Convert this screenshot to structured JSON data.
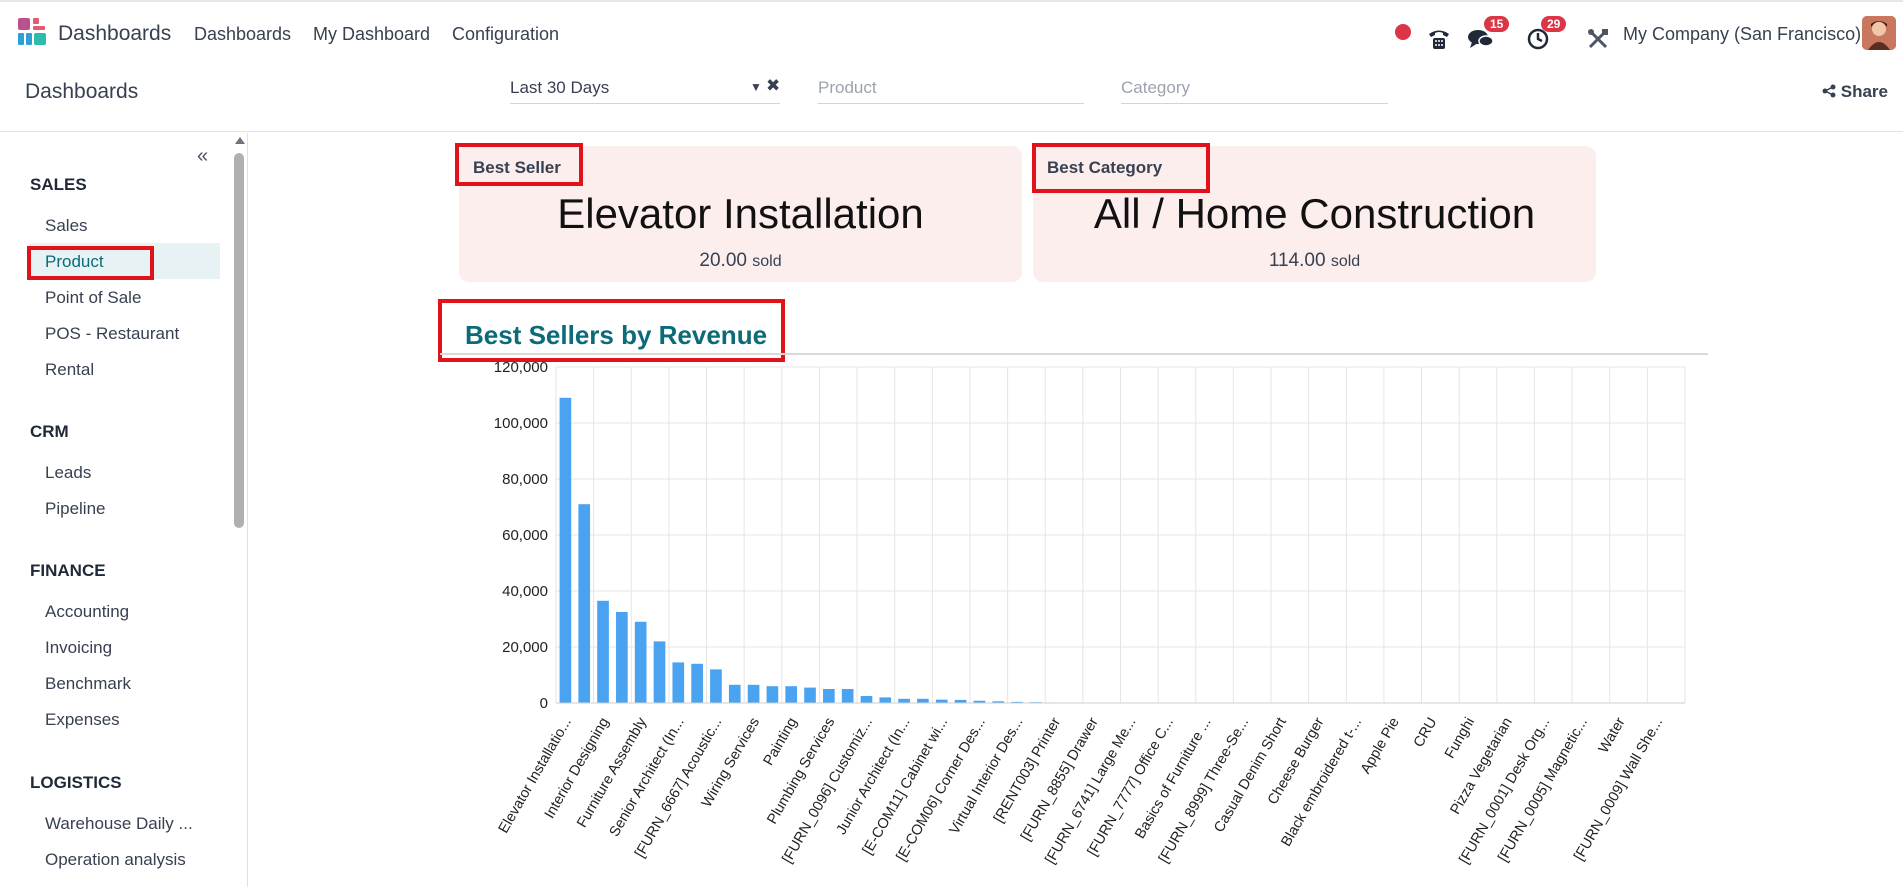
{
  "topbar": {
    "app_name": "Dashboards",
    "menu": [
      "Dashboards",
      "My Dashboard",
      "Configuration"
    ],
    "messages_count": "15",
    "activities_count": "29",
    "company": "My Company (San Francisco)"
  },
  "control": {
    "breadcrumb": "Dashboards",
    "date_filter": "Last 30 Days",
    "product_placeholder": "Product",
    "category_placeholder": "Category",
    "share_label": "Share"
  },
  "sidebar": {
    "sections": [
      {
        "title": "SALES",
        "items": [
          "Sales",
          "Product",
          "Point of Sale",
          "POS - Restaurant",
          "Rental"
        ]
      },
      {
        "title": "CRM",
        "items": [
          "Leads",
          "Pipeline"
        ]
      },
      {
        "title": "FINANCE",
        "items": [
          "Accounting",
          "Invoicing",
          "Benchmark",
          "Expenses"
        ]
      },
      {
        "title": "LOGISTICS",
        "items": [
          "Warehouse Daily ...",
          "Operation analysis"
        ]
      }
    ],
    "active_item": "Product"
  },
  "cards": [
    {
      "label": "Best Seller",
      "value": "Elevator Installation",
      "amount": "20.00",
      "unit": "sold"
    },
    {
      "label": "Best Category",
      "value": "All / Home Construction",
      "amount": "114.00",
      "unit": "sold"
    }
  ],
  "colors": {
    "bar": "#4aa3f0",
    "title": "#0b6b78",
    "card_bg": "#fdeeee",
    "highlight": "#e0121a",
    "active_nav": "#e6f2f3"
  },
  "chart_data": {
    "type": "bar",
    "title": "Best Sellers by Revenue",
    "ylim": [
      0,
      120000
    ],
    "yticks": [
      "0",
      "20,000",
      "40,000",
      "60,000",
      "80,000",
      "100,000",
      "120,000"
    ],
    "grid": true,
    "labels": [
      "Elevator Installatio...",
      "Interior Designing",
      "Furniture Assembly",
      "Senior Architect (In...",
      "[FURN_6667] Acoustic...",
      "Wiring Services",
      "Painting",
      "Plumbing Services",
      "[FURN_0096] Customiz...",
      "Junior Architect (In...",
      "[E-COM11] Cabinet wi...",
      "[E-COM06] Corner Des...",
      "Virtual Interior Des...",
      "[RENT003] Printer",
      "[FURN_8855] Drawer",
      "[FURN_6741] Large Me...",
      "[FURN_7777] Office C...",
      "Basics of Furniture ...",
      "[FURN_8999] Three-Se...",
      "Casual Denim Short",
      "Cheese Burger",
      "Black embroidered t-...",
      "Apple Pie",
      "CRU",
      "Funghi",
      "Pizza Vegetarian",
      "[FURN_0001] Desk Org...",
      "[FURN_0005] Magnetic...",
      "Water",
      "[FURN_0009] Wall She..."
    ],
    "values": [
      109000,
      71000,
      36500,
      32500,
      29000,
      22000,
      14500,
      14000,
      12000,
      6500,
      6500,
      6000,
      6000,
      5500,
      5000,
      5000,
      2500,
      2000,
      1500,
      1500,
      1200,
      1100,
      800,
      600,
      400,
      300,
      200,
      100,
      100,
      50,
      50,
      50,
      40,
      40,
      30,
      30,
      30,
      20,
      20,
      20,
      20,
      20,
      20,
      20,
      20,
      20,
      20,
      20,
      20,
      20,
      20,
      20,
      20,
      20,
      20,
      20,
      20,
      20,
      20,
      20
    ]
  }
}
